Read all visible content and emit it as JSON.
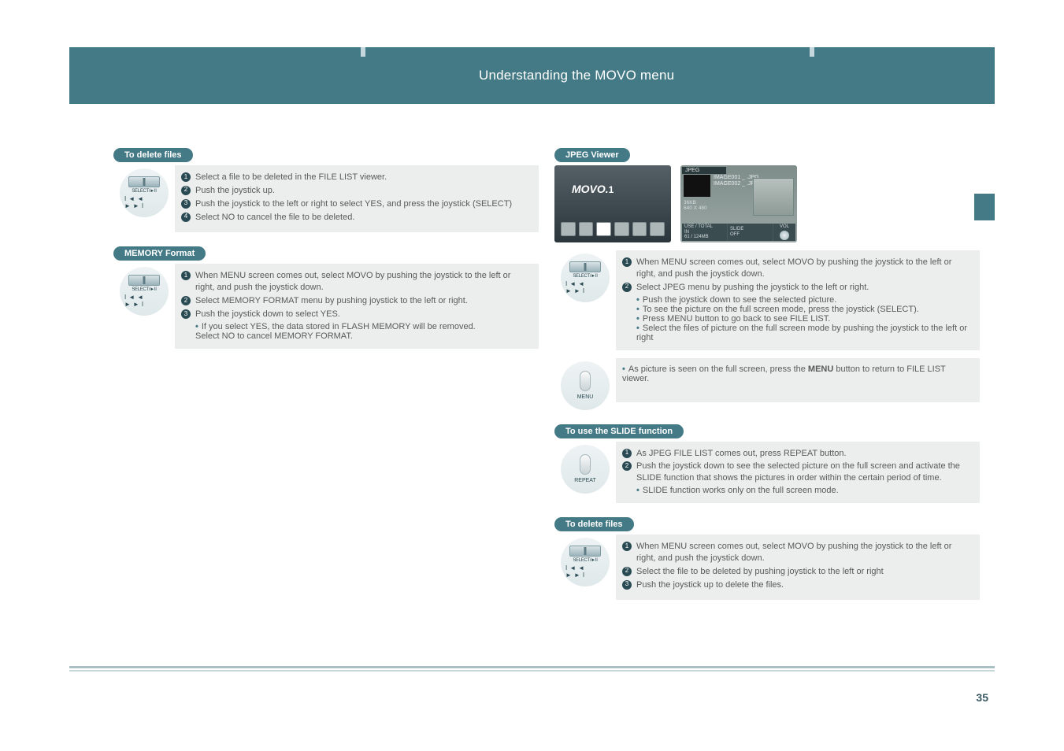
{
  "banner": {
    "title": "Understanding the MOVO menu"
  },
  "left": {
    "section1": {
      "pill": "To delete files",
      "items": [
        "Select a file to be deleted in the FILE LIST viewer.",
        "Push the joystick up.",
        "Push the joystick to the left or right to select YES, and press the joystick (SELECT)",
        "Select NO to cancel the file to be deleted."
      ]
    },
    "section2": {
      "pill": "MEMORY Format",
      "items": [
        "When MENU screen comes out, select MOVO by pushing the joystick to the left or right, and push the joystick down.",
        "Select MEMORY FORMAT menu by pushing joystick to the left or right.",
        "Push the joystick down to select YES."
      ],
      "note_bullet": "If you select YES, the data stored in FLASH MEMORY will be removed.",
      "note_plain": "Select NO to cancel MEMORY FORMAT."
    }
  },
  "right": {
    "movo_logo": "MOVO.",
    "movo_num": "1",
    "jpeg": {
      "hdr": "JPEG",
      "files": [
        "IMAGE001 _ .JPG",
        "IMAGE002 _ .JPG"
      ],
      "meta": [
        "36KB",
        "640 X 480"
      ],
      "bar": {
        "usetotal_label": "USE / TOTAL",
        "usetotal_sub": "IN",
        "usetotal_val": "61 / 124MB",
        "slide_label": "SLIDE",
        "slide_val": "OFF",
        "vol_label": "VOL"
      }
    },
    "sectionA": {
      "pill": "JPEG Viewer",
      "items": [
        "When MENU screen comes out, select MOVO by pushing the joystick to the left or right, and push the joystick down.",
        "Select JPEG menu by pushing the joystick to the left or right."
      ],
      "bullets": [
        "Push the joystick down to see the selected picture.",
        "To see the picture on the full screen mode, press the joystick (SELECT).",
        "Press MENU button to go back to see FILE LIST.",
        "Select the files of picture on the full screen mode by pushing the joystick to the left or right"
      ],
      "menu_note_pre": "As picture is seen on the full screen, press the ",
      "menu_note_bold": "MENU",
      "menu_note_post": " button to return to FILE LIST viewer."
    },
    "sectionB": {
      "pill": "To use the SLIDE function",
      "items": [
        "As JPEG FILE LIST comes out, press REPEAT button.",
        "Push the joystick down to see the selected picture on the full screen and activate the SLIDE function that shows the pictures in order within the certain period of time."
      ],
      "note": "SLIDE function works only on the full screen mode."
    },
    "sectionC": {
      "pill": "To delete files",
      "items": [
        "When MENU screen comes out, select MOVO by pushing the joystick to the left or right, and push the joystick down.",
        "Select the file to be deleted by pushing joystick to the left or right",
        "Push the joystick up to delete the files."
      ]
    }
  },
  "icons": {
    "select": "SELECT/►II",
    "arrows": "I◄◄   ►►I",
    "menu": "MENU",
    "repeat": "REPEAT"
  },
  "page_number": "35"
}
